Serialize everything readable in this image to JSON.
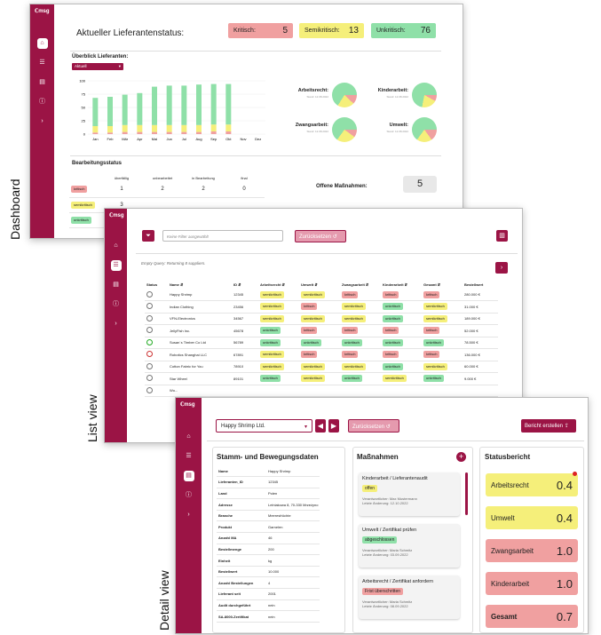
{
  "views": {
    "dashboard": "Dashboard",
    "list": "List view",
    "detail": "Detail view"
  },
  "brand": "ℂmsg",
  "dashboard": {
    "title": "Aktueller Lieferantenstatus:",
    "counts": [
      {
        "label": "Kritisch:",
        "value": "5",
        "color": "#f0a0a0"
      },
      {
        "label": "Semikritisch:",
        "value": "13",
        "color": "#f5ef7a"
      },
      {
        "label": "Unkritisch:",
        "value": "76",
        "color": "#8fe0a8"
      }
    ],
    "overview_title": "Überblick Lieferanten:",
    "select_value": "Aktuell",
    "chart_data": {
      "type": "bar",
      "categories": [
        "Jan",
        "Feb",
        "Mär",
        "Apr",
        "Mai",
        "Jun",
        "Jul",
        "Aug",
        "Sep",
        "Okt",
        "Nov",
        "Dez"
      ],
      "series": [
        {
          "name": "kritisch",
          "values": [
            3,
            3,
            4,
            4,
            4,
            4,
            4,
            4,
            5,
            5,
            0,
            0
          ]
        },
        {
          "name": "semikritisch",
          "values": [
            12,
            12,
            13,
            13,
            13,
            13,
            13,
            13,
            13,
            13,
            0,
            0
          ]
        },
        {
          "name": "unkritisch",
          "values": [
            53,
            55,
            57,
            60,
            72,
            74,
            74,
            76,
            76,
            76,
            0,
            0
          ]
        }
      ],
      "ylim": [
        0,
        100
      ],
      "yticks": [
        "100",
        "75",
        "50",
        "25",
        "0"
      ]
    },
    "pies": [
      {
        "label": "Arbeitsrecht:",
        "sub": "Stand: 12.08.2022"
      },
      {
        "label": "Kinderarbeit:",
        "sub": "Stand: 12.08.2022"
      },
      {
        "label": "Zwangsarbeit:",
        "sub": "Stand: 12.08.2022"
      },
      {
        "label": "Umwelt:",
        "sub": "Stand: 12.08.2022"
      }
    ],
    "proc_title": "Bearbeitungsstatus",
    "proc_headers": [
      "überfällig",
      "unbearbeitet",
      "in Bearbeitung",
      "final"
    ],
    "proc_rows": [
      {
        "label": "kritisch",
        "values": [
          "1",
          "2",
          "2",
          "0"
        ]
      },
      {
        "label": "semikritisch",
        "values": [
          "3",
          "",
          "",
          ""
        ]
      },
      {
        "label": "unkritisch",
        "values": [
          "",
          "",
          "",
          ""
        ]
      }
    ],
    "measures_label": "Offene Maßnahmen:",
    "measures_value": "5"
  },
  "list": {
    "filter_placeholder": "Keine Filter ausgewählt",
    "reset": "Zurücksetzen",
    "query": "Empty Query: Returning 8 suppliers.",
    "headers": [
      "Status",
      "Name",
      "ID",
      "Arbeitsrecht",
      "Umwelt",
      "Zwangsarbeit",
      "Kinderarbeit",
      "Gesamt",
      "Bestellwert"
    ],
    "rows": [
      {
        "name": "Happy Shrimp",
        "id": "12345",
        "a": "semikritisch",
        "u": "semikritisch",
        "z": "kritisch",
        "k": "kritisch",
        "g": "kritisch",
        "v": "280.000 €"
      },
      {
        "name": "Indian Clothing",
        "id": "23456",
        "a": "semikritisch",
        "u": "kritisch",
        "z": "semikritisch",
        "k": "unkritisch",
        "g": "semikritisch",
        "v": "31.000 €"
      },
      {
        "name": "VFN-Electronics",
        "id": "34567",
        "a": "semikritisch",
        "u": "semikritisch",
        "z": "semikritisch",
        "k": "unkritisch",
        "g": "semikritisch",
        "v": "189.000 €"
      },
      {
        "name": "JellyFish Inc.",
        "id": "45678",
        "a": "unkritisch",
        "u": "kritisch",
        "z": "kritisch",
        "k": "kritisch",
        "g": "kritisch",
        "v": "52.000 €"
      },
      {
        "name": "Susan´s Timber Co Ltd",
        "id": "56789",
        "a": "unkritisch",
        "u": "unkritisch",
        "z": "unkritisch",
        "k": "unkritisch",
        "g": "unkritisch",
        "v": "78.500 €"
      },
      {
        "name": "Robotics Shanghai LLC",
        "id": "67891",
        "a": "semikritisch",
        "u": "kritisch",
        "z": "kritisch",
        "k": "kritisch",
        "g": "kritisch",
        "v": "136.000 €"
      },
      {
        "name": "Cotton Fabric for You",
        "id": "78910",
        "a": "semikritisch",
        "u": "semikritisch",
        "z": "semikritisch",
        "k": "unkritisch",
        "g": "semikritisch",
        "v": "60.000 €"
      },
      {
        "name": "Star Wheel",
        "id": "89101",
        "a": "unkritisch",
        "u": "semikritisch",
        "z": "unkritisch",
        "k": "semikritisch",
        "g": "unkritisch",
        "v": "9.000 €"
      },
      {
        "name": "Wo...",
        "id": "",
        "a": "",
        "u": "",
        "z": "",
        "k": "",
        "g": "",
        "v": ""
      }
    ]
  },
  "detail": {
    "supplier_select": "Happy Shrimp Ltd.",
    "reset": "Zurücksetzen",
    "report_btn": "Bericht erstellen",
    "master_title": "Stamm- und Bewegungsdaten",
    "master_rows": [
      [
        "Name",
        "Happy Shrimp"
      ],
      [
        "Lieferanten_ID",
        "12345"
      ],
      [
        "Land",
        "Polen"
      ],
      [
        "Adresse",
        "Lelniakowa 8, 70-330 Mrzeżyno"
      ],
      [
        "Branche",
        "Meeresfrüchte"
      ],
      [
        "Produkt",
        "Garnelen"
      ],
      [
        "Anzahl MA",
        "46"
      ],
      [
        "Bestellmenge",
        "200"
      ],
      [
        "Einheit",
        "kg"
      ],
      [
        "Bestellwert",
        "10.000"
      ],
      [
        "Anzahl Bestellungen",
        "4"
      ],
      [
        "Lieferant seit",
        "2001"
      ],
      [
        "Audit durchgeführt",
        "nein"
      ],
      [
        "SA-8000-Zertifikat",
        "nein"
      ]
    ],
    "measures_title": "Maßnahmen",
    "measures": [
      {
        "title": "Kinderarbeit / Lieferantenaudit",
        "status": "offen",
        "color": "#f5ef7a",
        "owner": "Verantwortlicher: Max Mustermann",
        "date": "Letzte Änderung: 12.10.2022"
      },
      {
        "title": "Umwelt / Zertifikat prüfen",
        "status": "abgeschlossen",
        "color": "#8fe0a8",
        "owner": "Verantwortlicher: Maria Schmitz",
        "date": "Letzte Änderung: 03.09.2022"
      },
      {
        "title": "Arbeitsrecht / Zertifikat anfordern",
        "status": "Frist überschritten",
        "color": "#f0a0a0",
        "owner": "Verantwortlicher: Maria Schmitz",
        "date": "Letzte Änderung: 08.09.2022"
      }
    ],
    "status_title": "Statusbericht",
    "status": [
      {
        "label": "Arbeitsrecht",
        "value": "0.4",
        "color": "#f5ef7a"
      },
      {
        "label": "Umwelt",
        "value": "0.4",
        "color": "#f5ef7a"
      },
      {
        "label": "Zwangsarbeit",
        "value": "1.0",
        "color": "#f0a0a0"
      },
      {
        "label": "Kinderarbeit",
        "value": "1.0",
        "color": "#f0a0a0"
      },
      {
        "label": "Gesamt",
        "value": "0.7",
        "color": "#f0a0a0"
      }
    ]
  }
}
